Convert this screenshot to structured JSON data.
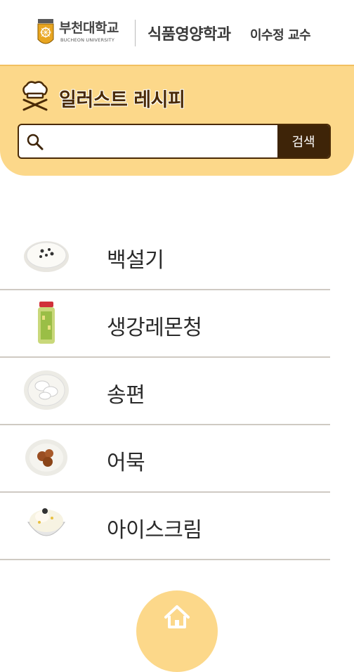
{
  "header": {
    "university_name_ko": "부천대학교",
    "university_name_en": "BUCHEON UNIVERSITY",
    "department": "식품영양학과",
    "professor": "이수정 교수"
  },
  "banner": {
    "title": "일러스트 레시피",
    "icon": "chef-hat-crossed-utensils-icon"
  },
  "search": {
    "placeholder": "",
    "value": "",
    "button_label": "검색",
    "icon": "search-icon"
  },
  "recipes": [
    {
      "name": "백설기",
      "thumb": "rice-cake-plate"
    },
    {
      "name": "생강레몬청",
      "thumb": "ginger-lemon-jar"
    },
    {
      "name": "송편",
      "thumb": "songpyeon-plate"
    },
    {
      "name": "어묵",
      "thumb": "fishcake-plate"
    },
    {
      "name": "아이스크림",
      "thumb": "ice-cream-bowl"
    }
  ],
  "nav": {
    "home_icon": "home-icon"
  },
  "colors": {
    "banner": "#fcd88a",
    "accent_dark": "#3e2408",
    "divider": "#cfcac3"
  }
}
